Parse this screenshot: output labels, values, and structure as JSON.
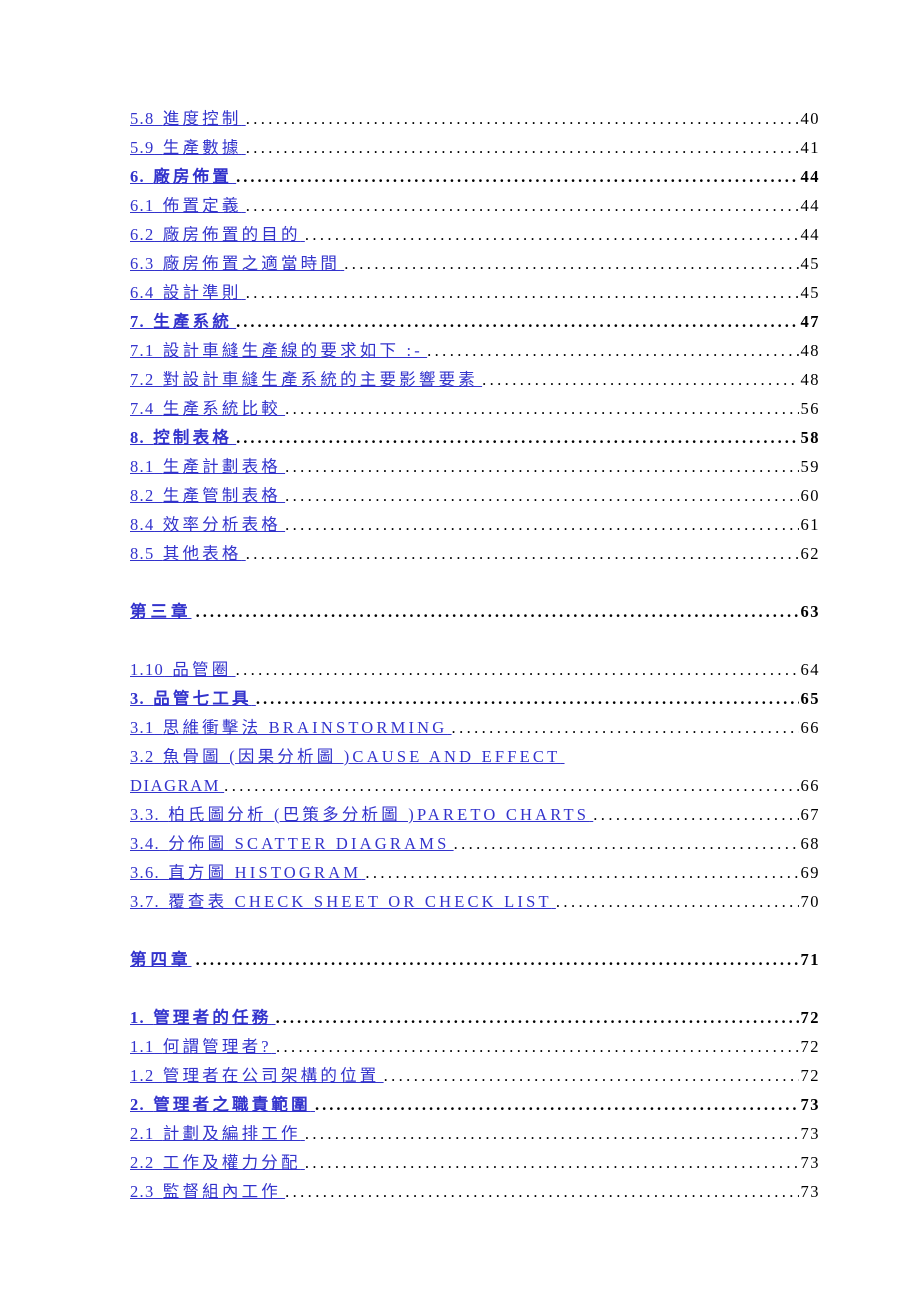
{
  "document": {
    "type": "table-of-contents",
    "text_color_link": "#3333CC",
    "text_color_plain": "#000000",
    "background": "#FFFFFF"
  },
  "toc": {
    "entries": [
      {
        "kind": "entry",
        "number": "5.8",
        "title": "進度控制",
        "page": "40"
      },
      {
        "kind": "entry",
        "number": "5.9",
        "title": "生產數據",
        "page": "41"
      },
      {
        "kind": "heading",
        "number": "6.",
        "title": "廠房佈置",
        "page": "44"
      },
      {
        "kind": "entry",
        "number": "6.1",
        "title": "佈置定義",
        "page": "44"
      },
      {
        "kind": "entry",
        "number": "6.2",
        "title": "廠房佈置的目的",
        "page": "44"
      },
      {
        "kind": "entry",
        "number": "6.3",
        "title": "廠房佈置之適當時間",
        "page": "45"
      },
      {
        "kind": "entry",
        "number": "6.4",
        "title": "設計準則",
        "page": "45"
      },
      {
        "kind": "heading",
        "number": "7.",
        "title": "生產系統",
        "page": "47"
      },
      {
        "kind": "entry",
        "number": "7.1",
        "title": "設計車縫生產線的要求如下 :-",
        "page": "48"
      },
      {
        "kind": "entry",
        "number": "7.2",
        "title": "對設計車縫生產系統的主要影響要素",
        "page": "48"
      },
      {
        "kind": "entry",
        "number": "7.4",
        "title": "生產系統比較",
        "page": "56"
      },
      {
        "kind": "heading",
        "number": "8.",
        "title": "控制表格",
        "page": "58"
      },
      {
        "kind": "entry",
        "number": "8.1",
        "title": "生產計劃表格",
        "page": "59"
      },
      {
        "kind": "entry",
        "number": "8.2",
        "title": "生產管制表格",
        "page": "60"
      },
      {
        "kind": "entry",
        "number": "8.4",
        "title": "效率分析表格",
        "page": "61"
      },
      {
        "kind": "entry",
        "number": "8.5",
        "title": "其他表格",
        "page": "62"
      },
      {
        "kind": "spacer"
      },
      {
        "kind": "chapter",
        "number": "",
        "title": "第三章",
        "page": "63"
      },
      {
        "kind": "spacer"
      },
      {
        "kind": "entry",
        "number": "1.10",
        "title": "品管圈",
        "page": "64"
      },
      {
        "kind": "heading",
        "number": "3.",
        "title": "品管七工具",
        "page": "65"
      },
      {
        "kind": "entry",
        "number": "3.1",
        "title": "思維衝擊法 BRAINSTORMING",
        "page": "66"
      },
      {
        "kind": "wrap-start",
        "number": "3.2",
        "title": "魚骨圖 (因果分析圖 )CAUSE AND EFFECT"
      },
      {
        "kind": "wrap-end",
        "number": "",
        "title": "DIAGRAM",
        "page": "66"
      },
      {
        "kind": "entry",
        "number": "3.3.",
        "title": "柏氏圖分析 (巴策多分析圖 )PARETO CHARTS",
        "page": "67"
      },
      {
        "kind": "entry",
        "number": "3.4.",
        "title": "分佈圖 SCATTER DIAGRAMS",
        "page": "68"
      },
      {
        "kind": "entry",
        "number": "3.6.",
        "title": "直方圖 HISTOGRAM",
        "page": "69"
      },
      {
        "kind": "entry",
        "number": "3.7.",
        "title": "覆查表 CHECK SHEET OR CHECK LIST",
        "page": "70"
      },
      {
        "kind": "spacer"
      },
      {
        "kind": "chapter",
        "number": "",
        "title": "第四章",
        "page": "71"
      },
      {
        "kind": "spacer"
      },
      {
        "kind": "heading",
        "number": "1.",
        "title": "管理者的任務",
        "page": "72"
      },
      {
        "kind": "entry",
        "number": "1.1",
        "title": "何謂管理者?",
        "page": "72"
      },
      {
        "kind": "entry",
        "number": "1.2",
        "title": "管理者在公司架構的位置",
        "page": "72"
      },
      {
        "kind": "heading",
        "number": "2.",
        "title": "管理者之職責範圍",
        "page": "73"
      },
      {
        "kind": "entry",
        "number": "2.1",
        "title": "計劃及編排工作",
        "page": "73"
      },
      {
        "kind": "entry",
        "number": "2.2",
        "title": "工作及權力分配",
        "page": "73"
      },
      {
        "kind": "entry",
        "number": "2.3",
        "title": "監督組內工作",
        "page": "73"
      }
    ]
  }
}
